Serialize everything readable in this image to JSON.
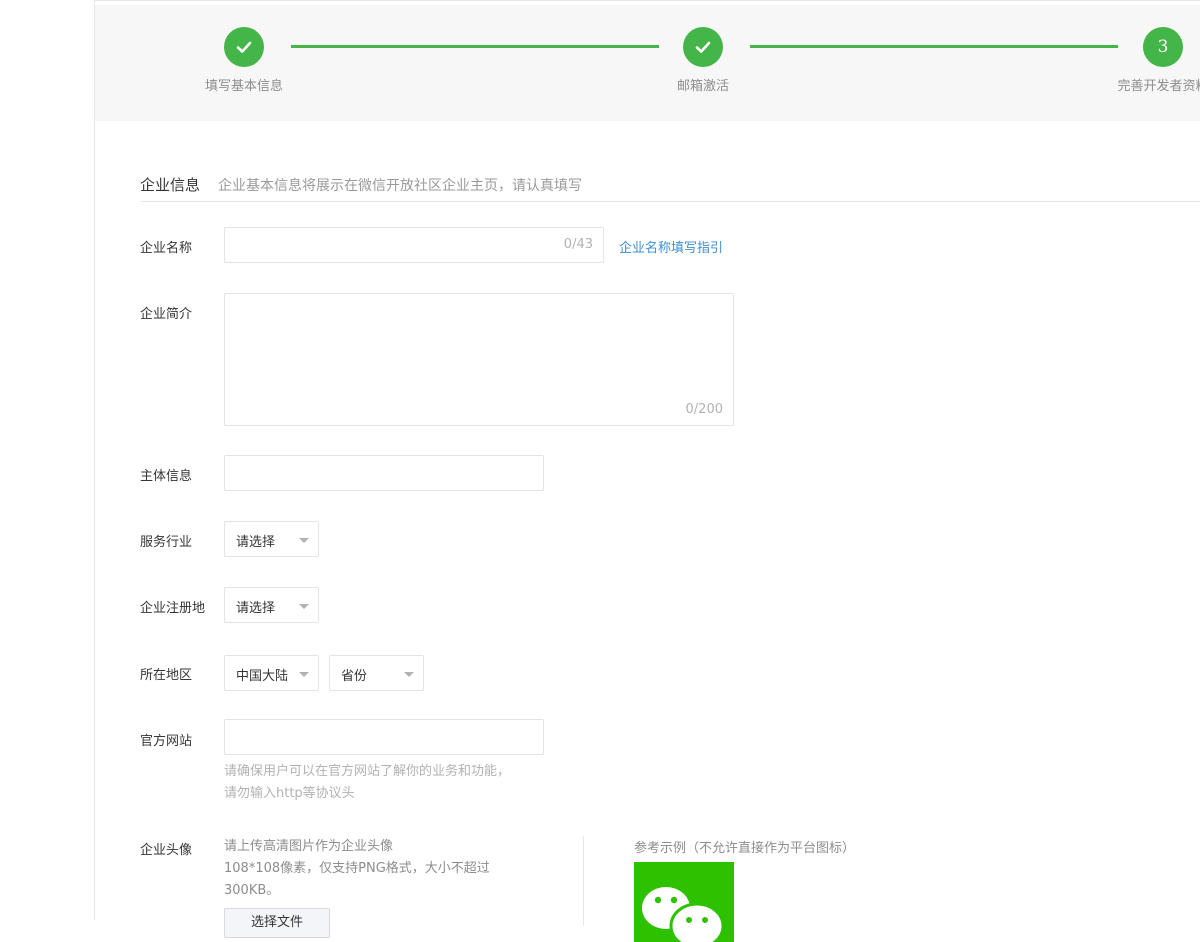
{
  "steps": [
    {
      "label": "填写基本信息",
      "state": "done"
    },
    {
      "label": "邮箱激活",
      "state": "done"
    },
    {
      "label": "完善开发者资料",
      "state": "current",
      "number": "3"
    }
  ],
  "section": {
    "title": "企业信息",
    "desc": "企业基本信息将展示在微信开放社区企业主页，请认真填写"
  },
  "form": {
    "company_name": {
      "label": "企业名称",
      "value": "",
      "counter": "0/43",
      "guide_link": "企业名称填写指引"
    },
    "company_intro": {
      "label": "企业简介",
      "value": "",
      "counter": "0/200"
    },
    "entity_info": {
      "label": "主体信息",
      "value": ""
    },
    "industry": {
      "label": "服务行业",
      "selected": "请选择"
    },
    "reg_place": {
      "label": "企业注册地",
      "selected": "请选择"
    },
    "region": {
      "label": "所在地区",
      "country": "中国大陆",
      "province": "省份"
    },
    "website": {
      "label": "官方网站",
      "value": "",
      "hint_line1": "请确保用户可以在官方网站了解你的业务和功能，",
      "hint_line2": "请勿输入http等协议头"
    },
    "avatar": {
      "label": "企业头像",
      "desc_line1": "请上传高清图片作为企业头像",
      "desc_line2": "108*108像素，仅支持PNG格式，大小不超过",
      "desc_line3": "300KB。",
      "file_button": "选择文件",
      "example_label": "参考示例（不允许直接作为平台图标）"
    }
  },
  "colors": {
    "accent": "#44b549",
    "link": "#3f8fd0",
    "example_bg": "#2dc100"
  }
}
